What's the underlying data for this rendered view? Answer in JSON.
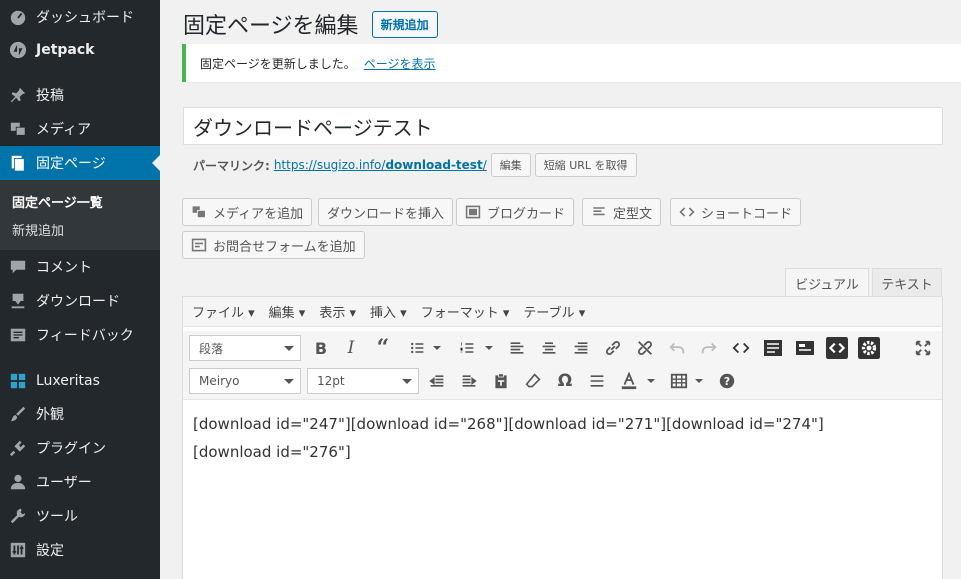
{
  "sidebar": {
    "items": [
      {
        "label": "ダッシュボード",
        "icon": "dashboard-icon"
      },
      {
        "label": "Jetpack",
        "icon": "jetpack-icon"
      },
      {
        "label": "投稿",
        "icon": "pin-icon"
      },
      {
        "label": "メディア",
        "icon": "media-icon"
      },
      {
        "label": "固定ページ",
        "icon": "page-icon"
      },
      {
        "label": "コメント",
        "icon": "comment-icon"
      },
      {
        "label": "ダウンロード",
        "icon": "download-icon"
      },
      {
        "label": "フィードバック",
        "icon": "feedback-icon"
      },
      {
        "label": "Luxeritas",
        "icon": "grid-icon"
      },
      {
        "label": "外観",
        "icon": "brush-icon"
      },
      {
        "label": "プラグイン",
        "icon": "plugin-icon"
      },
      {
        "label": "ユーザー",
        "icon": "user-icon"
      },
      {
        "label": "ツール",
        "icon": "wrench-icon"
      },
      {
        "label": "設定",
        "icon": "settings-icon"
      }
    ],
    "submenu": [
      "固定ページ一覧",
      "新規追加"
    ]
  },
  "header": {
    "title": "固定ページを編集",
    "add_new": "新規追加"
  },
  "notice": {
    "text": "固定ページを更新しました。",
    "link": "ページを表示"
  },
  "post_title": "ダウンロードページテスト",
  "permalink": {
    "label": "パーマリンク:",
    "url_base": "https://sugizo.info/",
    "url_slug": "download-test",
    "url_end": "/",
    "edit": "編集",
    "shortlink": "短縮 URL を取得"
  },
  "media_buttons": [
    "メディアを追加",
    "ダウンロードを挿入",
    "ブログカード",
    "定型文",
    "ショートコード",
    "お問合せフォームを追加"
  ],
  "tabs": {
    "visual": "ビジュアル",
    "text": "テキスト"
  },
  "menubar": [
    "ファイル ▾",
    "編集 ▾",
    "表示 ▾",
    "挿入 ▾",
    "フォーマット ▾",
    "テーブル ▾"
  ],
  "toolbar": {
    "format": "段落",
    "font": "Meiryo",
    "size": "12pt"
  },
  "content": "[download id=\"247\"][download id=\"268\"][download id=\"271\"][download id=\"274\"]\n[download id=\"276\"]",
  "colors": {
    "sidebar": "#23282d",
    "current": "#0073aa",
    "notice_border": "#46b450"
  }
}
